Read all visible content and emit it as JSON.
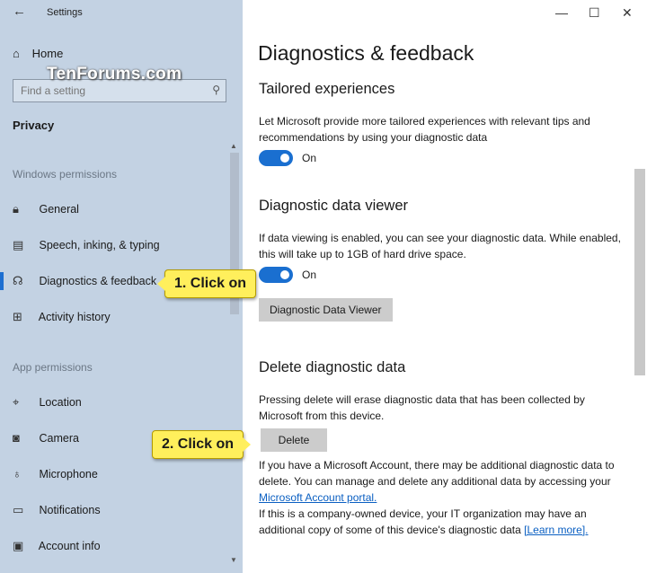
{
  "window": {
    "app_title": "Settings",
    "back_icon": "arrow-left-icon",
    "controls": [
      "—",
      "☐",
      "✕"
    ]
  },
  "watermark": "TenForums.com",
  "sidebar": {
    "home_label": "Home",
    "search_placeholder": "Find a setting",
    "section_title": "Privacy",
    "groups": [
      {
        "label": "Windows permissions",
        "items": [
          {
            "label": "General",
            "icon": "lock-icon"
          },
          {
            "label": "Speech, inking, & typing",
            "icon": "speech-icon"
          },
          {
            "label": "Diagnostics & feedback",
            "icon": "feedback-icon",
            "selected": true
          },
          {
            "label": "Activity history",
            "icon": "activity-icon"
          }
        ]
      },
      {
        "label": "App permissions",
        "items": [
          {
            "label": "Location",
            "icon": "location-icon"
          },
          {
            "label": "Camera",
            "icon": "camera-icon"
          },
          {
            "label": "Microphone",
            "icon": "microphone-icon"
          },
          {
            "label": "Notifications",
            "icon": "notifications-icon"
          },
          {
            "label": "Account info",
            "icon": "account-icon"
          }
        ]
      }
    ]
  },
  "main": {
    "title": "Diagnostics & feedback",
    "tailored": {
      "heading": "Tailored experiences",
      "text": "Let Microsoft provide more tailored experiences with relevant tips and recommendations by using your diagnostic data",
      "toggle_label": "On"
    },
    "viewer": {
      "heading": "Diagnostic data viewer",
      "text": "If data viewing is enabled, you can see your diagnostic data. While enabled, this will take up to 1GB of hard drive space.",
      "toggle_label": "On",
      "button_label": "Diagnostic Data Viewer"
    },
    "delete": {
      "heading": "Delete diagnostic data",
      "text": "Pressing delete will erase diagnostic data that has been collected by Microsoft from this device.",
      "button_label": "Delete",
      "info1_before": "If you have a Microsoft Account, there may be additional diagnostic data to delete. You can manage and delete any additional data by accessing your ",
      "info1_link": "Microsoft Account portal.",
      "info2_before": "If this is a company-owned device, your IT organization may have an additional copy of some of this device's diagnostic data ",
      "info2_link": "[Learn more]."
    }
  },
  "callouts": {
    "step1": "1. Click on",
    "step2": "2. Click on"
  },
  "colors": {
    "sidebar_bg": "#c3d2e3",
    "accent": "#1a6fd0",
    "callout_bg": "#ffef5c",
    "link": "#0a5fc2"
  }
}
